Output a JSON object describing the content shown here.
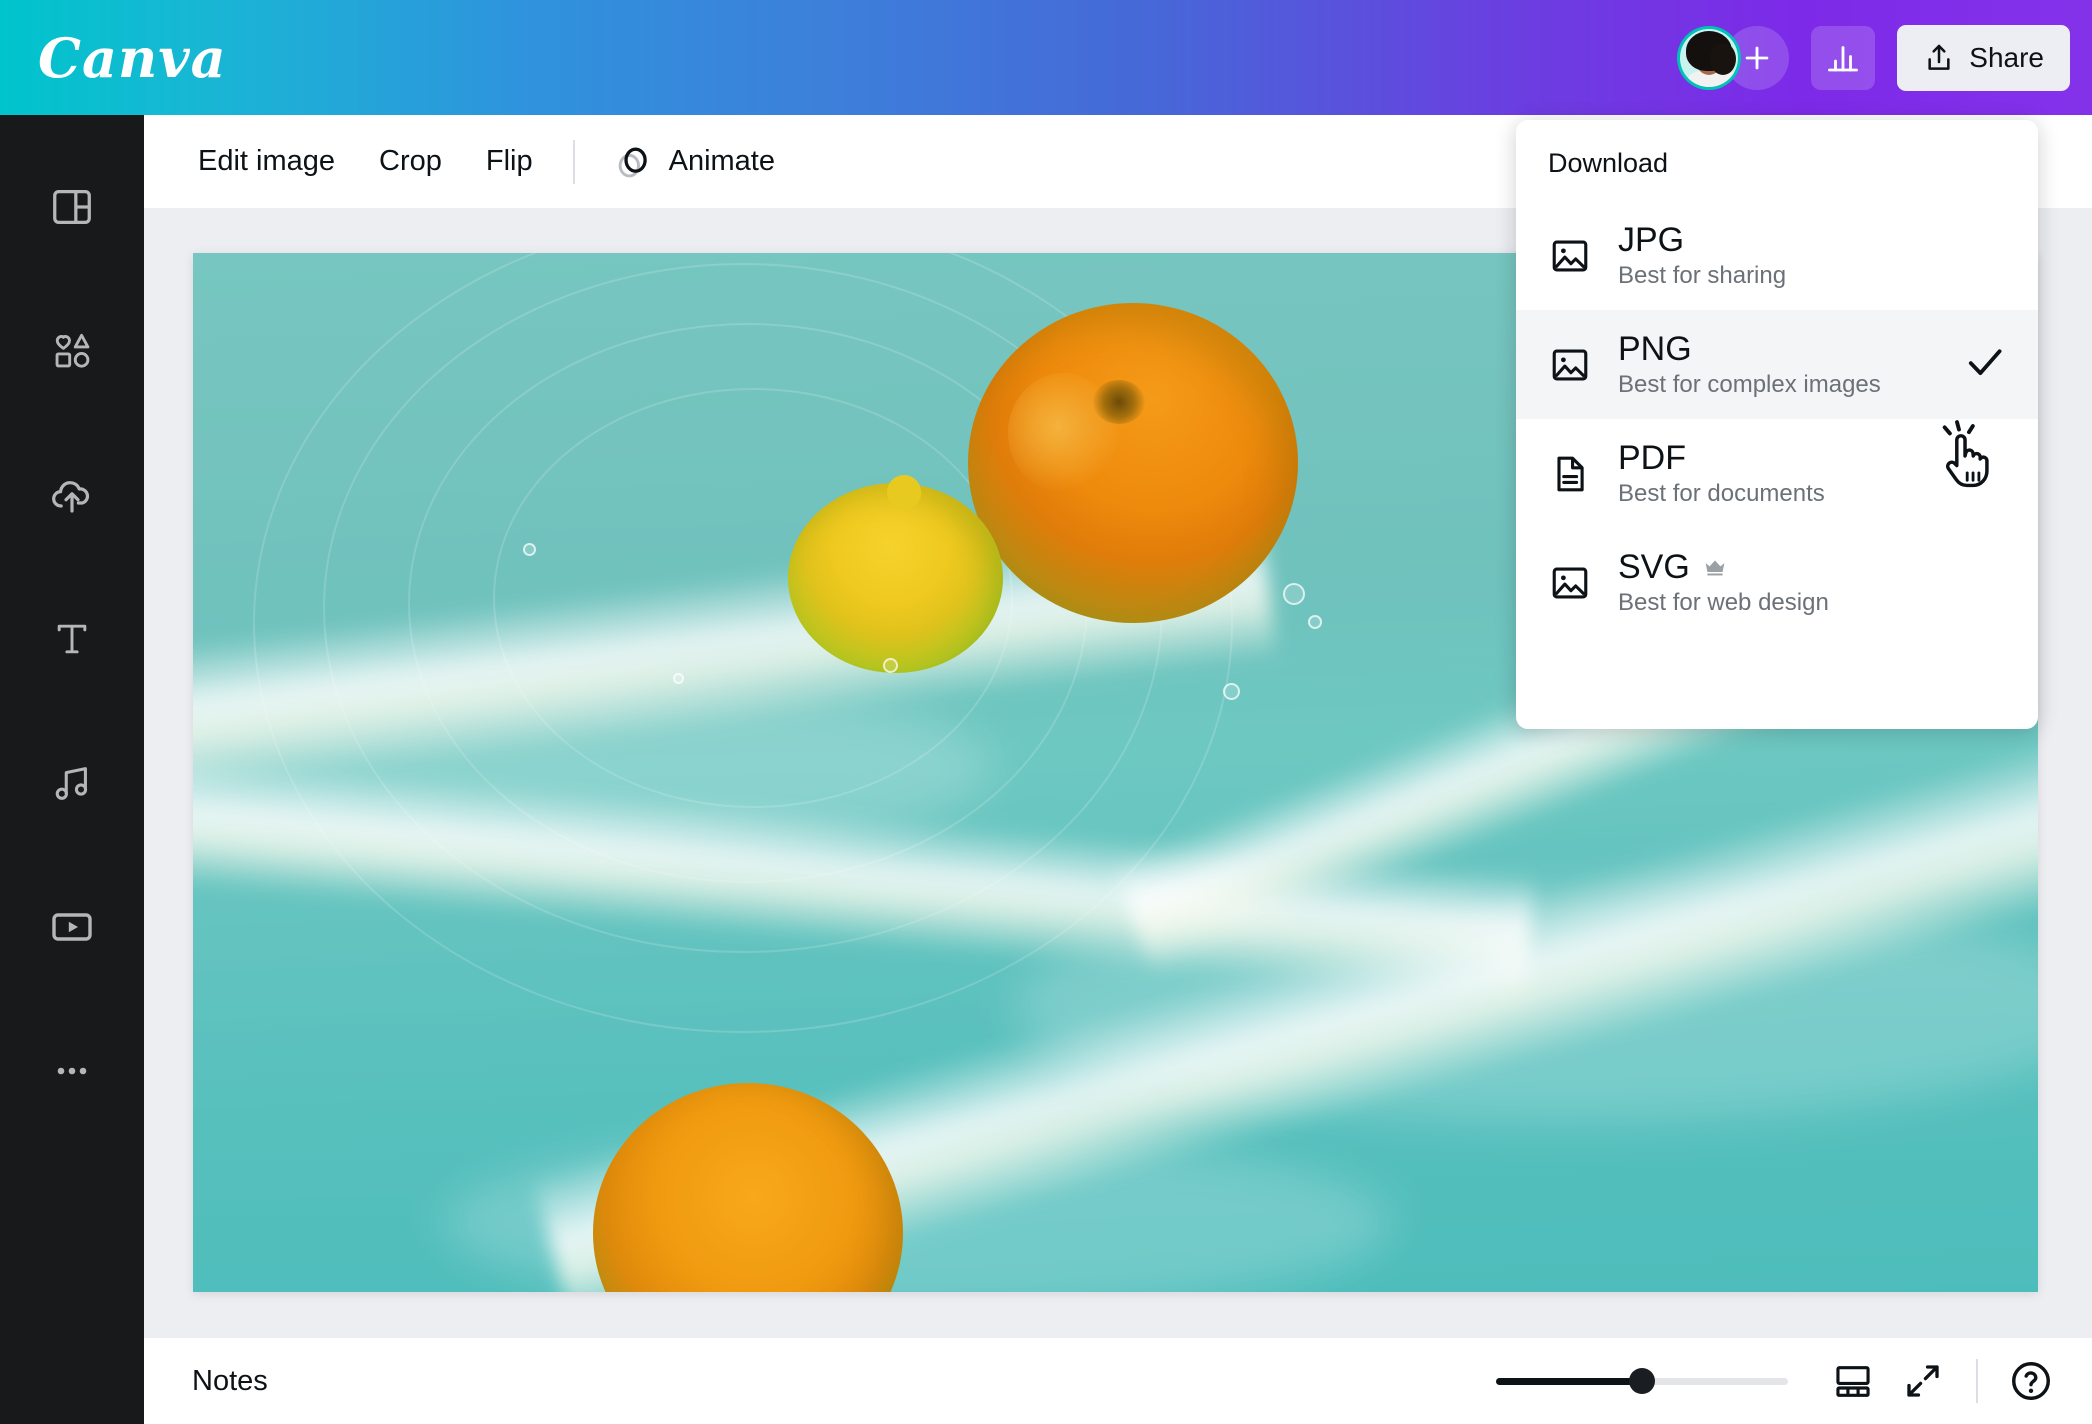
{
  "header": {
    "logo": "Canva",
    "avatar_name": "user-avatar",
    "add_collaborator_label": "+",
    "analytics_label": "analytics",
    "share_label": "Share"
  },
  "sidebar": {
    "items": [
      {
        "name": "design",
        "icon": "layout-panel-icon"
      },
      {
        "name": "elements",
        "icon": "shapes-icon"
      },
      {
        "name": "uploads",
        "icon": "cloud-upload-icon"
      },
      {
        "name": "text",
        "icon": "text-t-icon"
      },
      {
        "name": "audio",
        "icon": "music-note-icon"
      },
      {
        "name": "videos",
        "icon": "video-play-icon"
      },
      {
        "name": "more",
        "icon": "ellipsis-icon"
      }
    ]
  },
  "toolbar": {
    "edit_image": "Edit image",
    "crop": "Crop",
    "flip": "Flip",
    "animate": "Animate",
    "animate_icon": "animate-circles-icon"
  },
  "download": {
    "title": "Download",
    "options": [
      {
        "label": "JPG",
        "description": "Best for sharing",
        "icon": "image-icon",
        "selected": false,
        "pro": false
      },
      {
        "label": "PNG",
        "description": "Best for complex images",
        "icon": "image-icon",
        "selected": true,
        "pro": false
      },
      {
        "label": "PDF",
        "description": "Best for documents",
        "icon": "document-icon",
        "selected": false,
        "pro": false
      },
      {
        "label": "SVG",
        "description": "Best for web design",
        "icon": "image-icon",
        "selected": false,
        "pro": true
      }
    ]
  },
  "canvas": {
    "description": "Orange and lemon fruit floating in turquoise water with white foam",
    "fruits": [
      "orange",
      "lemon",
      "orange"
    ]
  },
  "bottombar": {
    "notes_label": "Notes",
    "zoom_percent": 50,
    "grid_view_icon": "page-grid-icon",
    "fullscreen_icon": "expand-arrows-icon",
    "help_icon": "help-question-icon"
  },
  "colors": {
    "brand_cyan": "#00c4cc",
    "brand_purple": "#7d2ae8",
    "sidebar_bg": "#18191b",
    "stage_bg": "#edeef2",
    "selected_row_bg": "#f4f5f7",
    "text_primary": "#0d1216",
    "text_muted": "#6b7177",
    "avatar_ring": "#00c2b5"
  }
}
